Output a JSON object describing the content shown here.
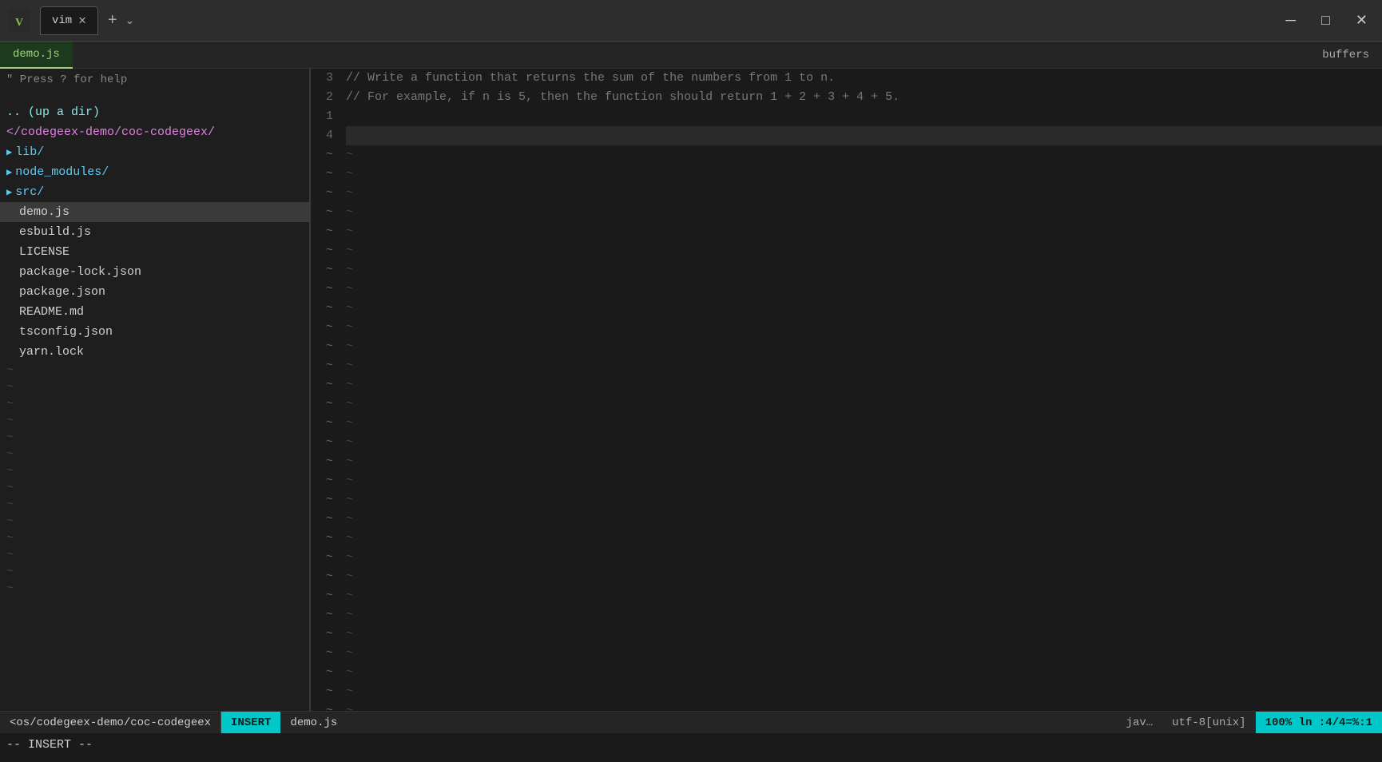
{
  "titlebar": {
    "logo_char": "🍃",
    "tab_name": "vim",
    "close_char": "✕",
    "add_char": "+",
    "chevron_char": "⌄",
    "minimize_char": "─",
    "maximize_char": "□",
    "window_close_char": "✕"
  },
  "editor_tabs": {
    "active_tab": "demo.js",
    "right_label": "buffers"
  },
  "sidebar": {
    "help_text": "\" Press ? for help",
    "up_dir_text": ".. (up a dir)",
    "current_path": "</codegeex-demo/coc-codegeex/",
    "folders": [
      {
        "name": "lib/"
      },
      {
        "name": "node_modules/"
      },
      {
        "name": "src/"
      }
    ],
    "files": [
      {
        "name": "demo.js",
        "active": true
      },
      {
        "name": "esbuild.js",
        "active": false
      },
      {
        "name": "LICENSE",
        "active": false
      },
      {
        "name": "package-lock.json",
        "active": false
      },
      {
        "name": "package.json",
        "active": false
      },
      {
        "name": "README.md",
        "active": false
      },
      {
        "name": "tsconfig.json",
        "active": false
      },
      {
        "name": "yarn.lock",
        "active": false
      }
    ],
    "tilde_count": 14
  },
  "editor": {
    "lines": [
      {
        "number": "3",
        "content": "// Write a function that returns the sum of the numbers from 1 to n.",
        "type": "comment"
      },
      {
        "number": "2",
        "content": "// For example, if n is 5, then the function should return 1 + 2 + 3 + 4 + 5.",
        "type": "comment"
      },
      {
        "number": "1",
        "content": "",
        "type": "normal"
      },
      {
        "number": "4",
        "content": "",
        "type": "active"
      }
    ],
    "tilde_count": 30
  },
  "statusbar": {
    "path": "<os/codegeex-demo/coc-codegeex",
    "mode": "INSERT",
    "filename": "demo.js",
    "filetype": "jav…",
    "encoding": "utf-8[unix]",
    "position": "100%  ln :4/4=%:1"
  },
  "cmdbar": {
    "text": "-- INSERT --"
  }
}
